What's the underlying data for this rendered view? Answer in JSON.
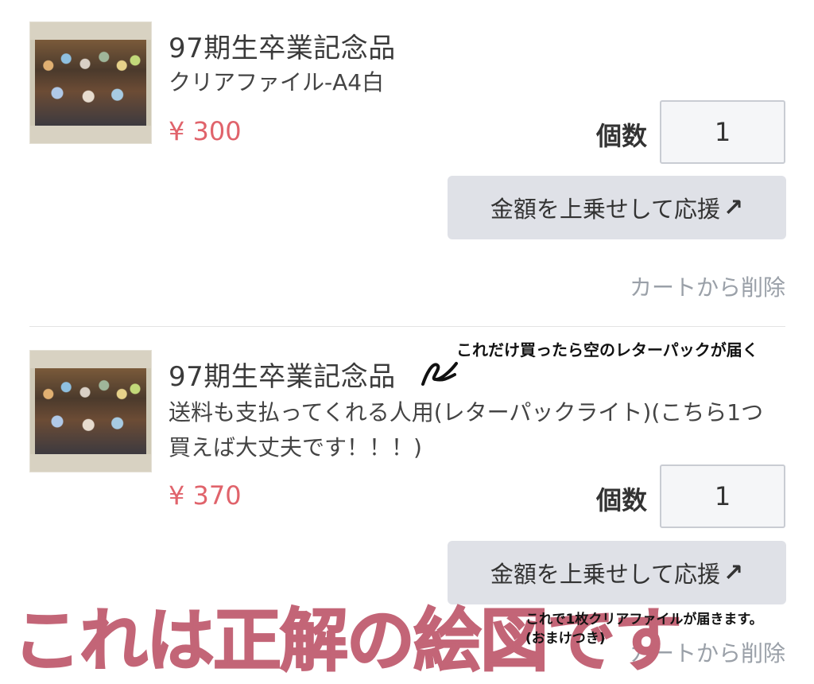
{
  "items": [
    {
      "title": "97期生卒業記念品",
      "subtitle": "クリアファイル-A4白",
      "price": "¥ 300",
      "qty_label": "個数",
      "qty_value": "1",
      "boost_label": "金額を上乗せして応援",
      "remove_label": "カートから削除"
    },
    {
      "title": "97期生卒業記念品",
      "subtitle": "送料も支払ってくれる人用(レターパックライト)(こちら1つ買えば大丈夫です！！！)",
      "price": "¥ 370",
      "qty_label": "個数",
      "qty_value": "1",
      "boost_label": "金額を上乗せして応援",
      "remove_label": "カートから削除"
    }
  ],
  "annotations": {
    "top_note": "これだけ買ったら空のレターパックが届く",
    "bottom_note_line1": "これで1枚クリアファイルが届きます。",
    "bottom_note_line2": "(おまけつき)",
    "big_overlay": "これは正解の絵図です"
  },
  "colors": {
    "price": "#e0636b",
    "button_bg": "#dfe1e7",
    "overlay": "#c36577",
    "muted": "#9aa0a8"
  },
  "icons": {
    "boost_arrow": "arrow-up-right-icon",
    "scribble": "hand-drawn-pen-mark"
  }
}
